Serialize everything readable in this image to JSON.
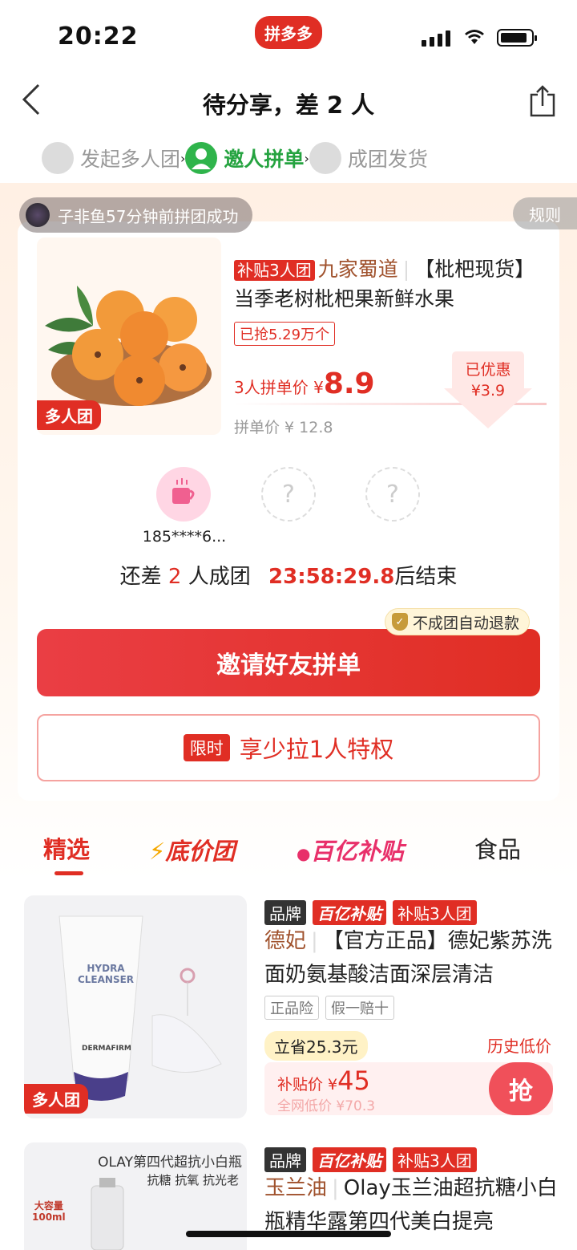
{
  "status_bar": {
    "time": "20:22",
    "app_badge": "拼多多"
  },
  "nav": {
    "title": "待分享，差 2 人"
  },
  "steps": [
    {
      "label": "发起多人团"
    },
    {
      "label": "邀人拼单"
    },
    {
      "label": "成团发货"
    }
  ],
  "group": {
    "success_notice": "子非鱼57分钟前拼团成功",
    "rules_label": "规则",
    "product": {
      "img_tag": "多人团",
      "sub_tag": "补贴3人团",
      "shop": "九家蜀道",
      "title": "【枇杷现货】当季老树枇杷果新鲜水果",
      "sold": "已抢5.29万个",
      "group_price_label": "3人拼单价 ¥",
      "group_price": "8.9",
      "single_price": "拼单价 ¥ 12.8",
      "saved_label": "已优惠",
      "saved_amount": "¥3.9"
    },
    "members": [
      {
        "name": "185****6..."
      }
    ],
    "remain": {
      "prefix": "还差",
      "count": "2",
      "suffix": "人成团",
      "timer": "23:58:29.8",
      "end": "后结束"
    },
    "refund_label": "不成团自动退款",
    "invite_label": "邀请好友拼单",
    "privilege": {
      "tag": "限时",
      "label": "享少拉1人特权"
    }
  },
  "tabs": [
    {
      "label": "精选"
    },
    {
      "label": "底价团"
    },
    {
      "label": "百亿补贴"
    },
    {
      "label": "食品"
    }
  ],
  "items": [
    {
      "img_tag": "多人团",
      "img_brand_line1": "HYDRA",
      "img_brand_line2": "CLEANSER",
      "img_maker": "DERMAFIRM",
      "tags": [
        "品牌",
        "百亿补贴",
        "补贴3人团"
      ],
      "brand": "德妃",
      "title": "【官方正品】德妃紫苏洗面奶氨基酸洁面深层清洁",
      "badges": [
        "正品险",
        "假一赔十"
      ],
      "save": "立省25.3元",
      "low_tip": "历史低价",
      "price_label": "补贴价 ¥",
      "price": "45",
      "market_price": "全网低价 ¥70.3",
      "grab": "抢"
    },
    {
      "img_text1": "OLAY第四代超抗小白瓶",
      "img_text2": "抗糖  抗氧  抗光老",
      "img_badge": "大容量",
      "img_badge2": "100ml",
      "tags": [
        "品牌",
        "百亿补贴",
        "补贴3人团"
      ],
      "brand": "玉兰油",
      "title": "Olay玉兰油超抗糖小白瓶精华露第四代美白提亮"
    }
  ],
  "colors": {
    "accent": "#e02e24",
    "green": "#2fb44b"
  }
}
